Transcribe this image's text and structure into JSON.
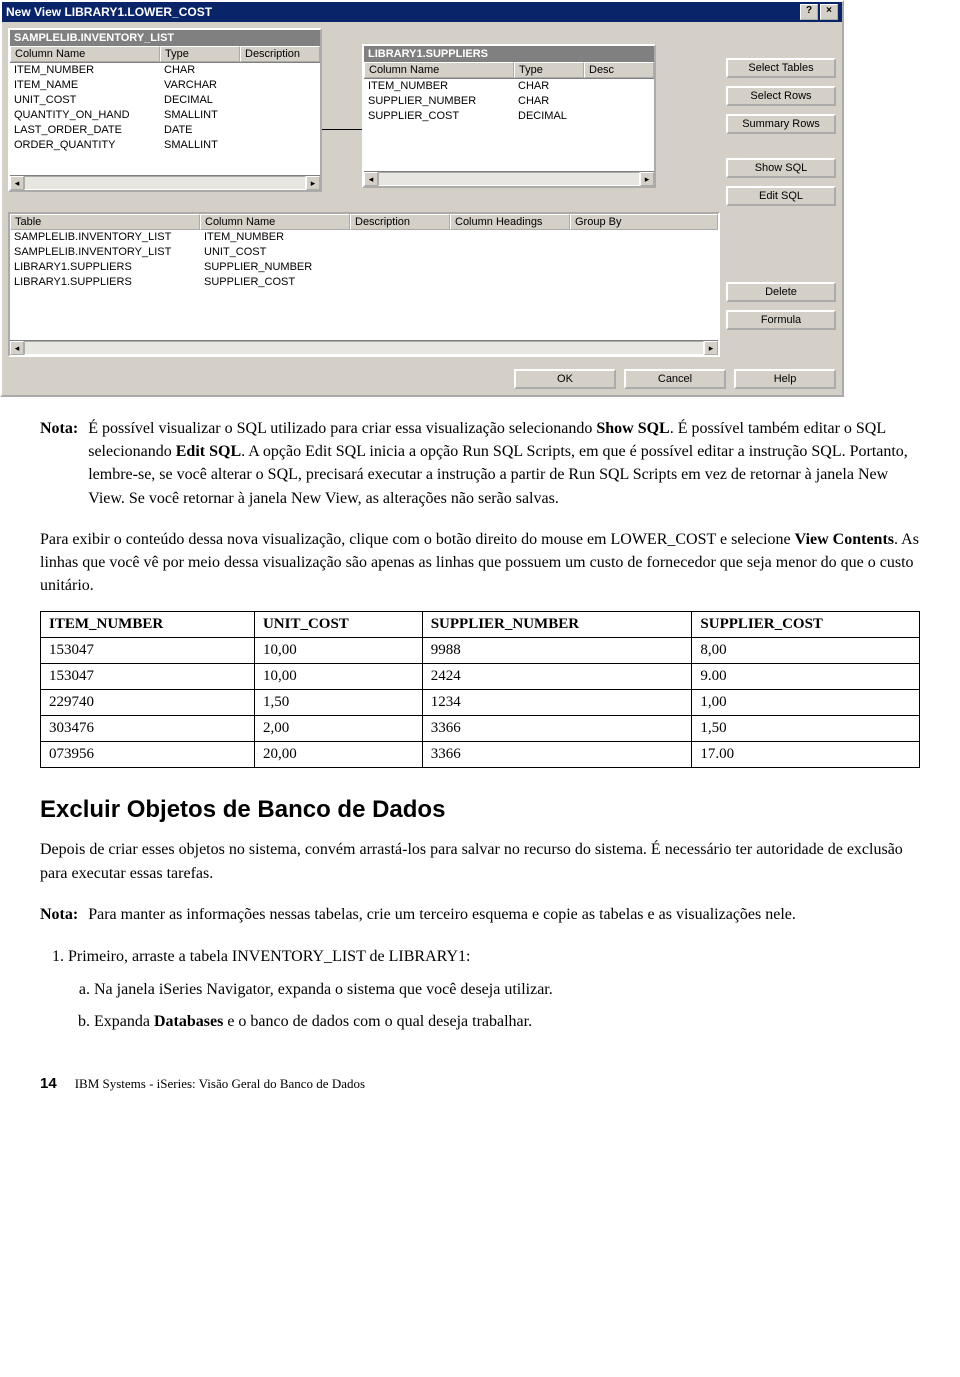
{
  "window": {
    "title": "New View LIBRARY1.LOWER_COST",
    "help_btn": "?",
    "close_btn": "×"
  },
  "box1": {
    "title": "SAMPLELIB.INVENTORY_LIST",
    "head": {
      "col": "Column Name",
      "type": "Type",
      "desc": "Description"
    },
    "rows": [
      {
        "col": "ITEM_NUMBER",
        "type": "CHAR"
      },
      {
        "col": "ITEM_NAME",
        "type": "VARCHAR"
      },
      {
        "col": "UNIT_COST",
        "type": "DECIMAL"
      },
      {
        "col": "QUANTITY_ON_HAND",
        "type": "SMALLINT"
      },
      {
        "col": "LAST_ORDER_DATE",
        "type": "DATE"
      },
      {
        "col": "ORDER_QUANTITY",
        "type": "SMALLINT"
      }
    ]
  },
  "box2": {
    "title": "LIBRARY1.SUPPLIERS",
    "head": {
      "col": "Column Name",
      "type": "Type",
      "desc": "Desc"
    },
    "rows": [
      {
        "col": "ITEM_NUMBER",
        "type": "CHAR"
      },
      {
        "col": "SUPPLIER_NUMBER",
        "type": "CHAR"
      },
      {
        "col": "SUPPLIER_COST",
        "type": "DECIMAL"
      }
    ]
  },
  "side_buttons": {
    "select_tables": "Select Tables",
    "select_rows": "Select Rows",
    "summary_rows": "Summary Rows",
    "show_sql": "Show SQL",
    "edit_sql": "Edit SQL"
  },
  "selgrid": {
    "head": {
      "tab": "Table",
      "col": "Column Name",
      "desc": "Description",
      "ch": "Column Headings",
      "grp": "Group By"
    },
    "rows": [
      {
        "tab": "SAMPLELIB.INVENTORY_LIST",
        "col": "ITEM_NUMBER"
      },
      {
        "tab": "SAMPLELIB.INVENTORY_LIST",
        "col": "UNIT_COST"
      },
      {
        "tab": "LIBRARY1.SUPPLIERS",
        "col": "SUPPLIER_NUMBER"
      },
      {
        "tab": "LIBRARY1.SUPPLIERS",
        "col": "SUPPLIER_COST"
      }
    ]
  },
  "side_buttons2": {
    "delete": "Delete",
    "formula": "Formula"
  },
  "bottom_buttons": {
    "ok": "OK",
    "cancel": "Cancel",
    "help": "Help"
  },
  "note1": {
    "label": "Nota:",
    "text_a": "É possível visualizar o SQL utilizado para criar essa visualização selecionando ",
    "bold_a": "Show SQL",
    "text_b": ". É possível também editar o SQL selecionando ",
    "bold_b": "Edit SQL",
    "text_c": ". A opção Edit SQL inicia a opção Run SQL Scripts, em que é possível editar a instrução SQL. Portanto, lembre-se, se você alterar o SQL, precisará executar a instrução a partir de Run SQL Scripts em vez de retornar à janela New View. Se você retornar à janela New View, as alterações não serão salvas."
  },
  "para2": {
    "a": "Para exibir o conteúdo dessa nova visualização, clique com o botão direito do mouse em LOWER_COST e selecione ",
    "bold": "View Contents",
    "b": ". As linhas que você vê por meio dessa visualização são apenas as linhas que possuem um custo de fornecedor que seja menor do que o custo unitário."
  },
  "table": {
    "headers": [
      "ITEM_NUMBER",
      "UNIT_COST",
      "SUPPLIER_NUMBER",
      "SUPPLIER_COST"
    ],
    "rows": [
      [
        "153047",
        "10,00",
        "9988",
        "8,00"
      ],
      [
        "153047",
        "10,00",
        "2424",
        "9.00"
      ],
      [
        "229740",
        "1,50",
        "1234",
        "1,00"
      ],
      [
        "303476",
        "2,00",
        "3366",
        "1,50"
      ],
      [
        "073956",
        "20,00",
        "3366",
        "17.00"
      ]
    ]
  },
  "section_heading": "Excluir Objetos de Banco de Dados",
  "para3": "Depois de criar esses objetos no sistema, convém arrastá-los para salvar no recurso do sistema. É necessário ter autoridade de exclusão para executar essas tarefas.",
  "note2": {
    "label": "Nota:",
    "text": "Para manter as informações nessas tabelas, crie um terceiro esquema e copie as tabelas e as visualizações nele."
  },
  "step1": "Primeiro, arraste a tabela INVENTORY_LIST de LIBRARY1:",
  "step1a": "Na janela iSeries Navigator, expanda o sistema que você deseja utilizar.",
  "step1b_a": "Expanda ",
  "step1b_bold": "Databases",
  "step1b_b": " e o banco de dados com o qual deseja trabalhar.",
  "footer": {
    "page": "14",
    "book": "IBM Systems - iSeries: Visão Geral do Banco de Dados"
  }
}
